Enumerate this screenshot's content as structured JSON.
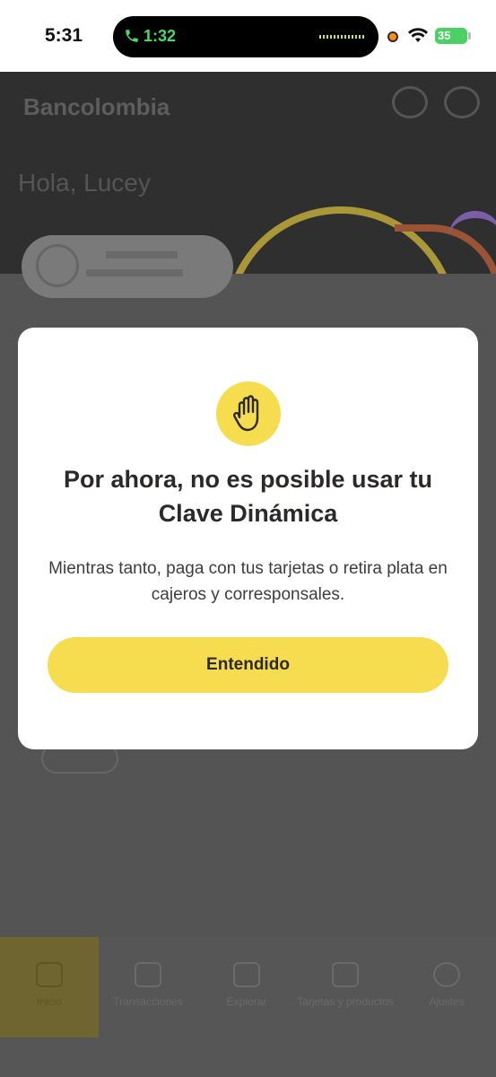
{
  "status_bar": {
    "time": "5:31",
    "call_timer": "1:32",
    "battery": "35"
  },
  "background_app": {
    "brand": "Bancolombia",
    "greeting": "Hola, Lucey",
    "nav_items": [
      {
        "label": "Inicio",
        "active": true
      },
      {
        "label": "Transacciones",
        "active": false
      },
      {
        "label": "Explorar",
        "active": false
      },
      {
        "label": "Tarjetas y productos",
        "active": false
      },
      {
        "label": "Ajustes",
        "active": false
      }
    ]
  },
  "modal": {
    "icon": "hand-stop-icon",
    "title": "Por ahora, no es posible usar tu Clave Dinámica",
    "body": "Mientras tanto, paga con tus tarjetas o retira plata en cajeros y corresponsales.",
    "button_label": "Entendido"
  },
  "colors": {
    "accent_yellow": "#f6dc4f",
    "overlay": "#565656",
    "text_dark": "#2c2a29"
  }
}
